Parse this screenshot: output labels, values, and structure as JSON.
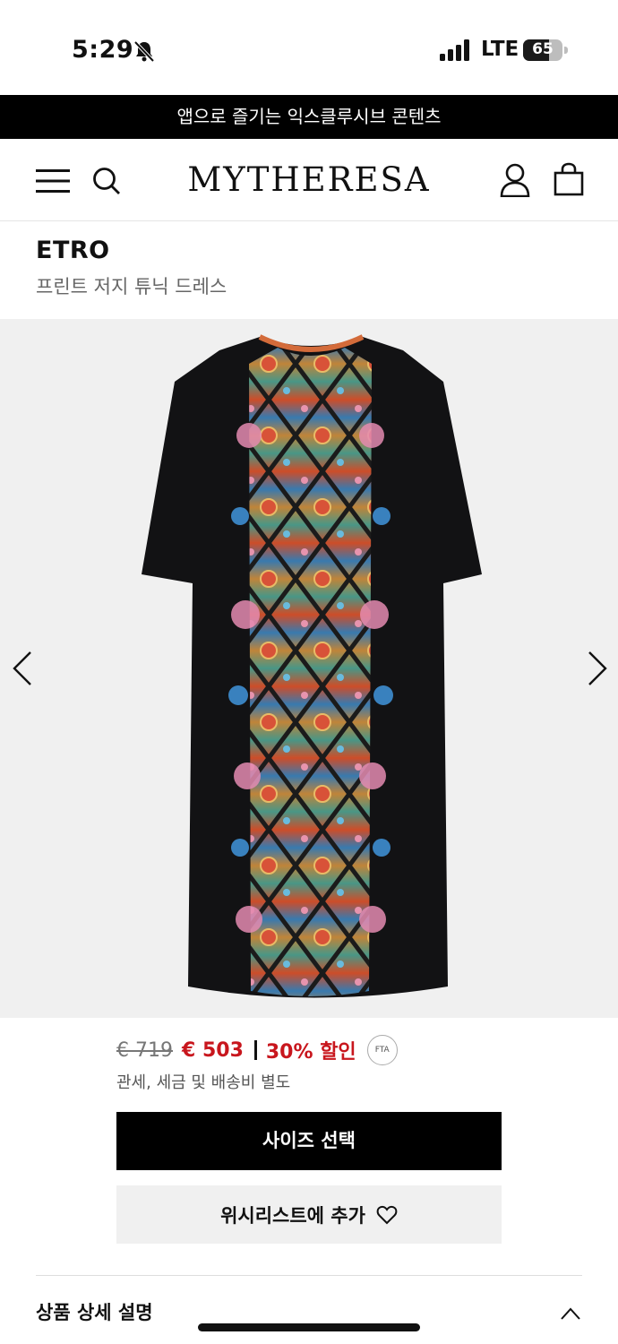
{
  "status_bar": {
    "time": "5:29",
    "network": "LTE",
    "battery": "65",
    "battery_level": 0.65
  },
  "banner": {
    "text": "앱으로 즐기는 익스클루시브 콘텐츠"
  },
  "header": {
    "logo": "MYTHERESA",
    "icons": [
      "menu-icon",
      "search-icon",
      "account-icon",
      "shopping-bag-icon"
    ]
  },
  "product": {
    "brand": "ETRO",
    "name": "프린트 저지 튜닉 드레스",
    "old_price": "€ 719",
    "new_price": "€ 503",
    "discount": "30% 할인",
    "fta_badge": "FTA",
    "tax_note": "관세, 세금 및 배송비 별도"
  },
  "gallery": {
    "icons": [
      "chevron-left-icon",
      "chevron-right-icon"
    ]
  },
  "actions": {
    "select_size": "사이즈 선택",
    "add_wishlist": "위시리스트에 추가"
  },
  "sections": {
    "details_title": "상품 상세 설명"
  },
  "colors": {
    "sale_red": "#c8161d",
    "black": "#000000",
    "button_gray": "#f0f0f0"
  }
}
